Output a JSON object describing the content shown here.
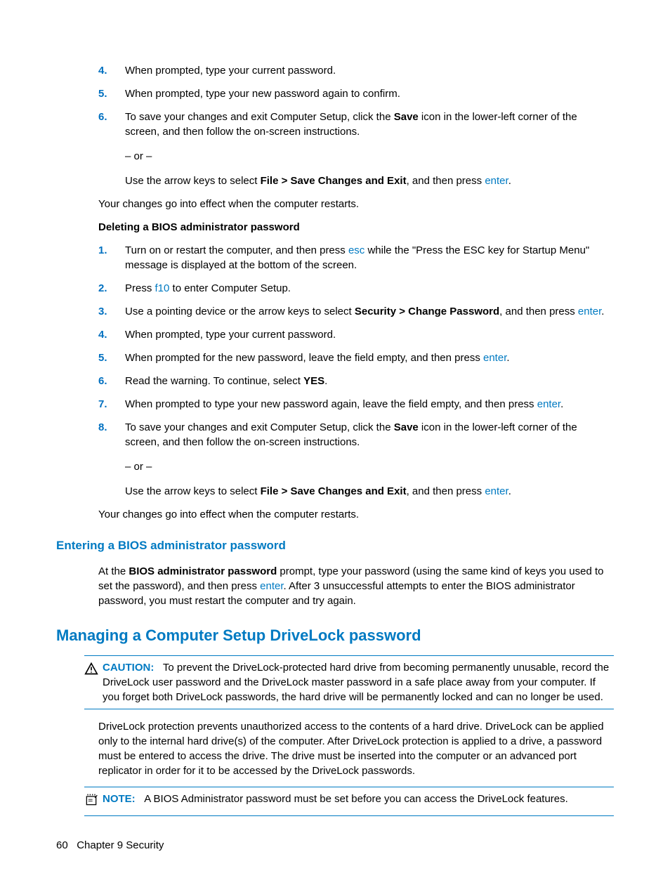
{
  "list1": [
    {
      "n": "4.",
      "text_a": "When prompted, type your current password."
    },
    {
      "n": "5.",
      "text_a": "When prompted, type your new password again to confirm."
    },
    {
      "n": "6.",
      "text_a": "To save your changes and exit Computer Setup, click the ",
      "bold_a": "Save",
      "text_b": " icon in the lower-left corner of the screen, and then follow the on-screen instructions.",
      "sub_or": "– or –",
      "sub_text_a": "Use the arrow keys to select ",
      "sub_bold": "File > Save Changes and Exit",
      "sub_text_b": ", and then press ",
      "sub_link": "enter",
      "sub_text_c": "."
    }
  ],
  "para_restart1": "Your changes go into effect when the computer restarts.",
  "sub_heading": "Deleting a BIOS administrator password",
  "list2": [
    {
      "n": "1.",
      "text_a": "Turn on or restart the computer, and then press ",
      "link_a": "esc",
      "text_b": " while the \"Press the ESC key for Startup Menu\" message is displayed at the bottom of the screen."
    },
    {
      "n": "2.",
      "text_a": "Press ",
      "link_a": "f10",
      "text_b": " to enter Computer Setup."
    },
    {
      "n": "3.",
      "text_a": "Use a pointing device or the arrow keys to select ",
      "bold_a": "Security > Change Password",
      "text_b": ", and then press ",
      "link_b": "enter",
      "text_c": "."
    },
    {
      "n": "4.",
      "text_a": "When prompted, type your current password."
    },
    {
      "n": "5.",
      "text_a": "When prompted for the new password, leave the field empty, and then press ",
      "link_a": "enter",
      "text_b": "."
    },
    {
      "n": "6.",
      "text_a": "Read the warning. To continue, select ",
      "bold_a": "YES",
      "text_b": "."
    },
    {
      "n": "7.",
      "text_a": "When prompted to type your new password again, leave the field empty, and then press ",
      "link_a": "enter",
      "text_b": "."
    },
    {
      "n": "8.",
      "text_a": "To save your changes and exit Computer Setup, click the ",
      "bold_a": "Save",
      "text_b": " icon in the lower-left corner of the screen, and then follow the on-screen instructions.",
      "sub_or": "– or –",
      "sub_text_a": "Use the arrow keys to select ",
      "sub_bold": "File > Save Changes and Exit",
      "sub_text_b": ", and then press ",
      "sub_link": "enter",
      "sub_text_c": "."
    }
  ],
  "para_restart2": "Your changes go into effect when the computer restarts.",
  "h3_enter": "Entering a BIOS administrator password",
  "enter_para": {
    "a": "At the ",
    "bold": "BIOS administrator password",
    "b": " prompt, type your password (using the same kind of keys you used to set the password), and then press ",
    "link": "enter",
    "c": ". After 3 unsuccessful attempts to enter the BIOS administrator password, you must restart the computer and try again."
  },
  "h2_manage": "Managing a Computer Setup DriveLock password",
  "caution": {
    "label": "CAUTION:",
    "text": "To prevent the DriveLock-protected hard drive from becoming permanently unusable, record the DriveLock user password and the DriveLock master password in a safe place away from your computer. If you forget both DriveLock passwords, the hard drive will be permanently locked and can no longer be used."
  },
  "drivelock_para": "DriveLock protection prevents unauthorized access to the contents of a hard drive. DriveLock can be applied only to the internal hard drive(s) of the computer. After DriveLock protection is applied to a drive, a password must be entered to access the drive. The drive must be inserted into the computer or an advanced port replicator in order for it to be accessed by the DriveLock passwords.",
  "note": {
    "label": "NOTE:",
    "text": "A BIOS Administrator password must be set before you can access the DriveLock features."
  },
  "footer": {
    "page": "60",
    "chapter": "Chapter 9   Security"
  }
}
